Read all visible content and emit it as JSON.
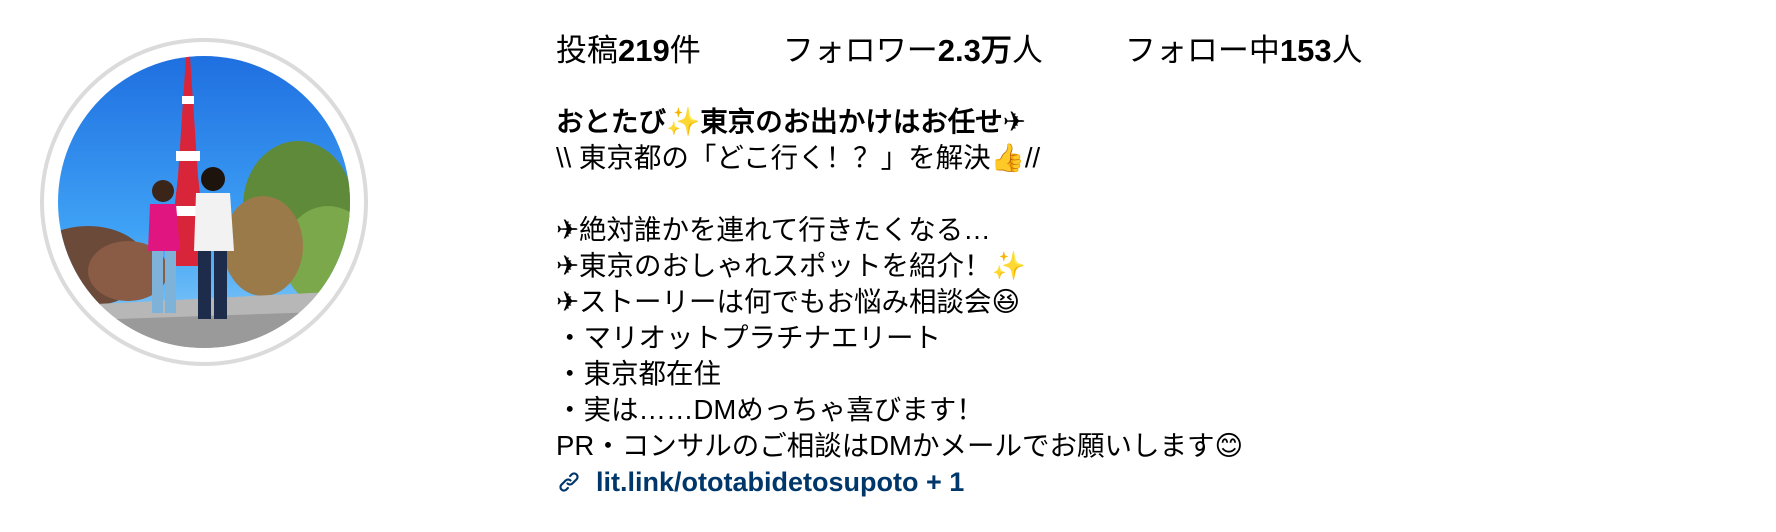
{
  "profile": {
    "avatar": {
      "icon": "profile-photo-tokyo-tower"
    },
    "stats": {
      "posts": {
        "prefix": "投稿",
        "value": "219",
        "suffix": "件"
      },
      "followers": {
        "prefix": "フォロワー",
        "value": "2.3万",
        "suffix": "人"
      },
      "following": {
        "prefix": "フォロー中",
        "value": "153",
        "suffix": "人"
      }
    },
    "bio": {
      "name": "おとたび✨東京のお出かけはお任せ✈",
      "lines": [
        "\\\\ 東京都の「どこ行く！？」を解決👍//",
        "",
        "✈絶対誰かを連れて行きたくなる…",
        "✈東京のおしゃれスポットを紹介！✨",
        "✈ストーリーは何でもお悩み相談会😆",
        "・マリオットプラチナエリート",
        "・東京都在住",
        "・実は……DMめっちゃ喜びます！",
        "PR・コンサルのご相談はDMかメールでお願いします😊"
      ],
      "link": {
        "text": "lit.link/ototabidetosupoto + 1",
        "icon": "link-icon"
      }
    }
  },
  "colors": {
    "link": "#00376b",
    "ring": "#dbdbdb"
  }
}
